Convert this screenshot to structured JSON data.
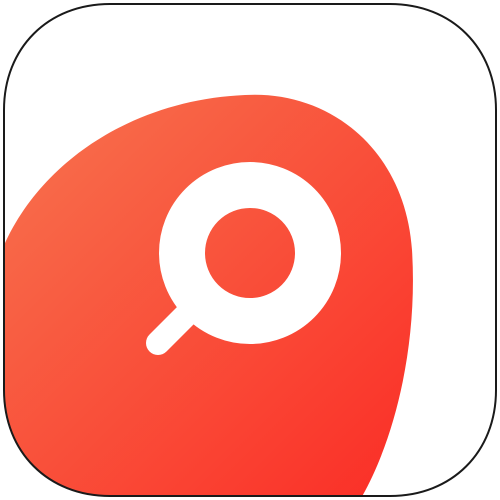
{
  "icon": {
    "name": "search-app-icon",
    "glyph": "search-icon",
    "colors": {
      "tile_background": "#ffffff",
      "tile_border": "#1a1a1a",
      "blob_gradient_start": "#f7744f",
      "blob_gradient_end": "#fb2d26",
      "glyph": "#ffffff"
    }
  }
}
